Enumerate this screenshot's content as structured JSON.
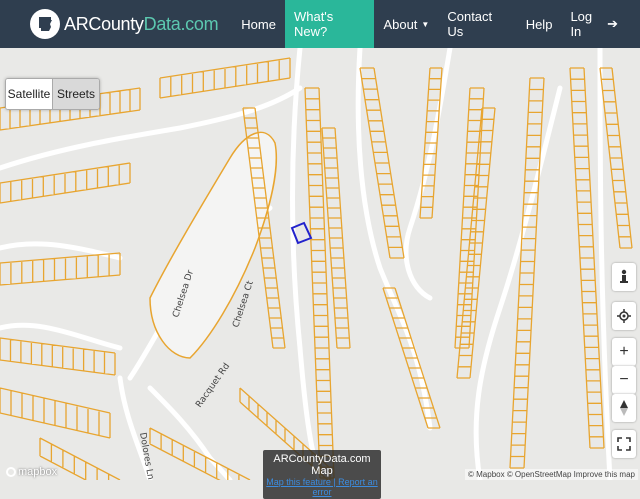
{
  "brand": {
    "name_prefix": "ARCounty",
    "name_suffix": "Data.com"
  },
  "nav": {
    "items": [
      "Home",
      "What's New?",
      "About",
      "Contact Us",
      "Help"
    ],
    "login": "Log In",
    "active_color": "#2ab79a",
    "bar_color": "#2f3e4f"
  },
  "map": {
    "layers": {
      "satellite": "Satellite",
      "streets": "Streets",
      "active": "Satellite"
    },
    "streets": [
      "Chelsea Dr",
      "Chelsea Ct",
      "Racquet Rd",
      "Dolores Ln"
    ],
    "parcel_color": "#e8a530",
    "selected_parcel_color": "#2222cc",
    "controls": {
      "zoom_in": "+",
      "zoom_out": "−"
    },
    "logo": "mapbox",
    "attribution": "© Mapbox © OpenStreetMap Improve this map",
    "info_title": "ARCountyData.com Map",
    "info_sub": "Map this feature | Report an error"
  }
}
